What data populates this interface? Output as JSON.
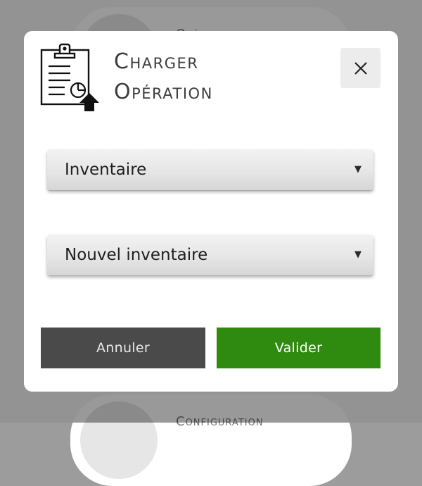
{
  "background": {
    "top_item_label": "Opérations",
    "bottom_item_label": "Configuration"
  },
  "dialog": {
    "icon": "clipboard-upload-icon",
    "title_line1": "Charger",
    "title_line2": "Opération",
    "close_icon": "close-icon",
    "operation_type_select": {
      "selected": "Inventaire"
    },
    "operation_select": {
      "selected": "Nouvel inventaire"
    },
    "cancel_label": "Annuler",
    "confirm_label": "Valider"
  },
  "colors": {
    "confirm": "#2f8a10",
    "cancel": "#4a4a4a",
    "overlay": "rgba(0,0,0,0.40)"
  }
}
